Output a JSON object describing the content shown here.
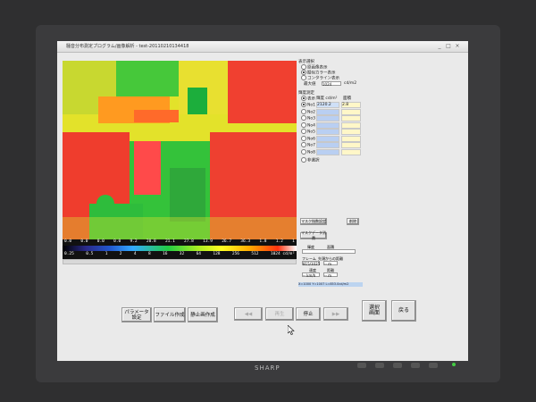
{
  "window": {
    "title": "騒音分布測定プログラム/画像解析 - test-20110210134418",
    "controls": [
      "_",
      "□",
      "×"
    ]
  },
  "colorbar": {
    "upper_ticks": [
      "0.0",
      "0.0",
      "0.0",
      "0.0",
      "9.2",
      "20.8",
      "21.1",
      "27.8",
      "13.9",
      "26.7",
      "36.3",
      "1.8",
      "1.2",
      "1"
    ],
    "lower_ticks": [
      "0.25",
      "0.5",
      "1",
      "2",
      "4",
      "8",
      "16",
      "32",
      "64",
      "128",
      "256",
      "512",
      "1024 cd/m²"
    ],
    "colors": [
      "#000000",
      "#2a2a8a",
      "#2255cc",
      "#33aaff",
      "#22cc44",
      "#aaee22",
      "#ffff22",
      "#ffaa00",
      "#ff3311",
      "#ffffff"
    ]
  },
  "bottom_buttons": {
    "parameter": "パラメータ\n設定",
    "file_create": "ファイル作成",
    "still_create": "静止画作成",
    "rewind": "◀◀",
    "play": "再生",
    "stop": "停止",
    "fast_forward": "▶▶",
    "select_screen": "選択\n画面",
    "back": "戻る"
  },
  "panel": {
    "display_section": "表示選択",
    "display_options": [
      "原画像表示",
      "擬似カラー表示",
      "コンタライン表示"
    ],
    "max_value_label": "最大値",
    "max_value": "1024",
    "max_unit": "cd/m2",
    "measure_section": "輝度測定",
    "measure_header_display": "表示",
    "measure_header_lum": "輝度 cd/m²",
    "measure_header_area": "面積",
    "rows": [
      {
        "label": "No1",
        "value": "2120.2",
        "area": "2.8"
      },
      {
        "label": "No2",
        "value": "",
        "area": ""
      },
      {
        "label": "No3",
        "value": "",
        "area": ""
      },
      {
        "label": "No4",
        "value": "",
        "area": ""
      },
      {
        "label": "No5",
        "value": "",
        "area": ""
      },
      {
        "label": "No6",
        "value": "",
        "area": ""
      },
      {
        "label": "No7",
        "value": "",
        "area": ""
      },
      {
        "label": "No8",
        "value": "",
        "area": ""
      }
    ],
    "no_select": "非選択",
    "mask_btn": "マスク指数設定",
    "delete_btn": "削除",
    "mask_data_btn": "マスクデータ消費",
    "lum_label": "輝度",
    "area_label": "面積",
    "frame_label": "フレーム",
    "frame_value": "815/1025",
    "from_start_label": "先頭からの距離",
    "from_start_value": "-- m",
    "speed_label": "速度",
    "speed_value": "-- km/h",
    "dist_label": "距離",
    "dist_value": "-- m",
    "status": "X=1000 Y=1007 L=853.0cd/m2"
  },
  "monitor": {
    "brand": "SHARP"
  }
}
